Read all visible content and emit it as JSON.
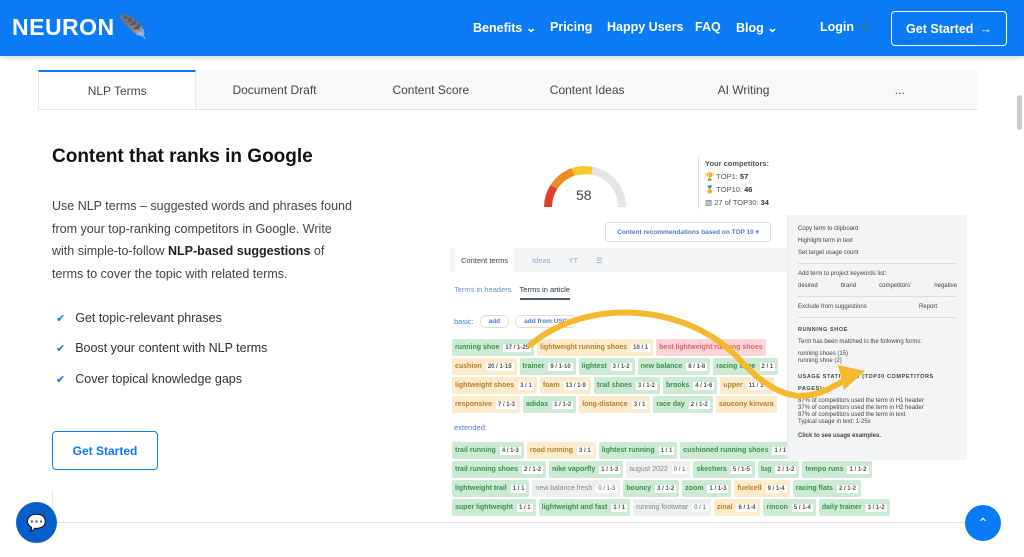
{
  "header": {
    "logo": "NEURON",
    "nav": [
      {
        "label": "Benefits",
        "dropdown": true
      },
      {
        "label": "Pricing"
      },
      {
        "label": "Happy Users"
      },
      {
        "label": "FAQ"
      },
      {
        "label": "Blog",
        "dropdown": true
      }
    ],
    "login": "Login",
    "cta": "Get Started"
  },
  "tabs": [
    "NLP Terms",
    "Document Draft",
    "Content Score",
    "Content Ideas",
    "AI Writing",
    "..."
  ],
  "main": {
    "title": "Content that ranks in Google",
    "para_1": "Use NLP terms – suggested words and phrases found from your top-ranking competitors in Google. Write with simple-to-follow ",
    "para_bold": "NLP-based suggestions",
    "para_2": " of terms to cover the topic with related terms.",
    "checks": [
      "Get topic-relevant phrases",
      "Boost your content with NLP terms",
      "Cover topical knowledge gaps"
    ],
    "cta": "Get Started"
  },
  "colors": {
    "brand": "#0a7bf5",
    "green_chip": "#cdebd4",
    "orange_chip": "#fbebcd",
    "red_chip": "#fad5d8",
    "arrow": "#f5b82e"
  },
  "screenshot": {
    "score": "58",
    "competitors_title": "Your competitors:",
    "competitors": [
      {
        "label": "TOP1: ",
        "value": "57"
      },
      {
        "label": "TOP10: ",
        "value": "46"
      },
      {
        "label": "27 of TOP30: ",
        "value": "34"
      }
    ],
    "recommendation": "Content recommendations based on TOP 10",
    "panel_tabs": [
      "Content terms",
      "Ideas",
      "YT"
    ],
    "sub_tabs": [
      "Terms in headers",
      "Terms in article"
    ],
    "basic_label": "basic:",
    "add": "add",
    "add_from": "add from USC",
    "extended_label": "extended:",
    "basic_rows": [
      [
        [
          "running shoe",
          "17 / 1-25",
          "g"
        ],
        [
          "lightweight running shoes",
          "10 / 1",
          "o"
        ],
        [
          "best lightweight running shoes",
          "",
          "r"
        ]
      ],
      [
        [
          "cushion",
          "20 / 1-15",
          "o"
        ],
        [
          "trainer",
          "9 / 1-10",
          "g"
        ],
        [
          "lightest",
          "3 / 1-2",
          "g"
        ],
        [
          "new balance",
          "8 / 1-8",
          "g"
        ],
        [
          "racing shoe",
          "2 / 1",
          "g"
        ]
      ],
      [
        [
          "lightweight shoes",
          "3 / 1",
          "o"
        ],
        [
          "foam",
          "13 / 1-9",
          "o"
        ],
        [
          "trail shoes",
          "3 / 1-2",
          "g"
        ],
        [
          "brooks",
          "4 / 1-6",
          "g"
        ],
        [
          "upper",
          "11 / 1-8",
          "o"
        ]
      ],
      [
        [
          "responsive",
          "7 / 1-3",
          "o"
        ],
        [
          "adidas",
          "1 / 1-2",
          "g"
        ],
        [
          "long-distance",
          "3 / 1",
          "o"
        ],
        [
          "race day",
          "2 / 1-2",
          "g"
        ],
        [
          "saucony kinvara",
          "",
          "o"
        ]
      ]
    ],
    "extended_rows": [
      [
        [
          "trail running",
          "4 / 1-3",
          "g"
        ],
        [
          "road running",
          "3 / 1",
          "o"
        ],
        [
          "lightest running",
          "1 / 1",
          "g"
        ],
        [
          "cushioned running shoes",
          "1 / 1",
          "g"
        ]
      ],
      [
        [
          "trail running shoes",
          "2 / 1-2",
          "g"
        ],
        [
          "nike vaporfly",
          "1 / 1-3",
          "g"
        ],
        [
          "august 2022",
          "0 / 1",
          "x"
        ],
        [
          "skechers",
          "5 / 1-5",
          "g"
        ],
        [
          "lug",
          "2 / 1-2",
          "g"
        ],
        [
          "tempo runs",
          "1 / 1-2",
          "g"
        ]
      ],
      [
        [
          "lightweight trail",
          "1 / 1",
          "g"
        ],
        [
          "new balance fresh",
          "0 / 1-3",
          "x"
        ],
        [
          "bouncy",
          "3 / 1-2",
          "g"
        ],
        [
          "zoom",
          "1 / 1-3",
          "g"
        ],
        [
          "fuelcell",
          "9 / 1-4",
          "o"
        ],
        [
          "racing flats",
          "2 / 1-2",
          "g"
        ]
      ],
      [
        [
          "super lightweight",
          "1 / 1",
          "g"
        ],
        [
          "lightweight and fast",
          "1 / 1",
          "g"
        ],
        [
          "running footwear",
          "0 / 1",
          "x"
        ],
        [
          "zinal",
          "6 / 1-4",
          "o"
        ],
        [
          "rincon",
          "5 / 1-4",
          "g"
        ],
        [
          "daily trainer",
          "3 / 1-2",
          "g"
        ]
      ]
    ],
    "side": {
      "actions": [
        "Copy term to clipboard",
        "Highlight term in text",
        "Set target usage count"
      ],
      "add_title": "Add term to project keywords list:",
      "add_opts": [
        "desired",
        "brand",
        "competitors'",
        "negative"
      ],
      "exclude": "Exclude from suggestions",
      "report": "Report",
      "term": "RUNNING SHOE",
      "matched": "Term has been matched in the following forms:",
      "forms": [
        "running shoes (15)",
        "running shoe (2)"
      ],
      "usage_title": "USAGE STATISTICS (TOP30 COMPETITORS PAGES):",
      "usage": [
        "87% of competitors used the term in H1 header",
        "37% of competitors used the term in H2 header",
        "87% of competitors used the term in text"
      ],
      "typical": "Typical usage in text: 1-25x",
      "examples": "Click to see usage examples."
    }
  }
}
